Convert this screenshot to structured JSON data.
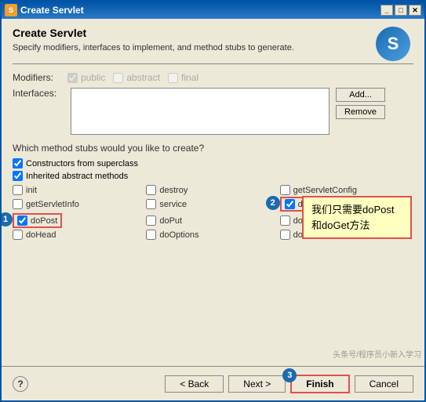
{
  "window": {
    "title": "Create Servlet",
    "icon_label": "S"
  },
  "header": {
    "title": "Create Servlet",
    "description": "Specify modifiers, interfaces to implement, and method stubs to generate."
  },
  "modifiers": {
    "label": "Modifiers:",
    "items": [
      {
        "label": "public",
        "checked": true
      },
      {
        "label": "abstract",
        "checked": false
      },
      {
        "label": "final",
        "checked": false
      }
    ]
  },
  "interfaces": {
    "label": "Interfaces:"
  },
  "buttons": {
    "add": "Add...",
    "remove": "Remove"
  },
  "stubs_section": {
    "question": "Which method stubs would you like to create?",
    "full_rows": [
      {
        "label": "Constructors from superclass",
        "checked": true
      },
      {
        "label": "Inherited abstract methods",
        "checked": true
      }
    ],
    "grid_items": [
      {
        "col": 0,
        "label": "init",
        "checked": false
      },
      {
        "col": 1,
        "label": "destroy",
        "checked": false
      },
      {
        "col": 2,
        "label": "getServletConfig",
        "checked": false
      },
      {
        "col": 0,
        "label": "getServletInfo",
        "checked": false
      },
      {
        "col": 1,
        "label": "service",
        "checked": false
      },
      {
        "col": 2,
        "label": "doGet",
        "checked": true,
        "highlighted": true
      },
      {
        "col": 0,
        "label": "doPost",
        "checked": true,
        "highlighted": true
      },
      {
        "col": 1,
        "label": "doPut",
        "checked": false
      },
      {
        "col": 2,
        "label": "doDelete",
        "checked": false
      },
      {
        "col": 0,
        "label": "doHead",
        "checked": false
      },
      {
        "col": 1,
        "label": "doOptions",
        "checked": false
      },
      {
        "col": 2,
        "label": "doTrace",
        "checked": false
      }
    ]
  },
  "tooltip": {
    "text": "我们只需要doPost\n和doGet方法"
  },
  "badges": {
    "badge1": "1",
    "badge2": "2",
    "badge3": "3"
  },
  "bottom": {
    "back": "< Back",
    "next": "Next >",
    "finish": "Finish",
    "cancel": "Cancel"
  },
  "watermark": "头条号/程序员小新入学习"
}
